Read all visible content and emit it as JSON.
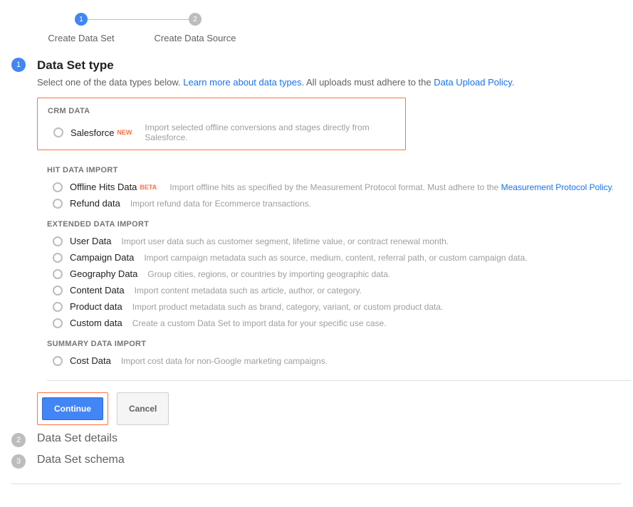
{
  "stepper": {
    "step1": {
      "num": "1",
      "label": "Create Data Set"
    },
    "step2": {
      "num": "2",
      "label": "Create Data Source"
    }
  },
  "section1": {
    "num": "1",
    "title": "Data Set type",
    "intro_prefix": "Select one of the data types below. ",
    "intro_link1": "Learn more about data types",
    "intro_mid": ". All uploads must adhere to the ",
    "intro_link2": "Data Upload Policy",
    "intro_suffix": "."
  },
  "groups": {
    "crm": {
      "header": "CRM DATA",
      "salesforce": {
        "label": "Salesforce",
        "badge": "NEW",
        "desc": "Import selected offline conversions and stages directly from Salesforce."
      }
    },
    "hit": {
      "header": "HIT DATA IMPORT",
      "offline": {
        "label": "Offline Hits Data",
        "badge": "BETA",
        "desc_pre": "Import offline hits as specified by the Measurement Protocol format. Must adhere to the ",
        "desc_link": "Measurement Protocol Policy",
        "desc_post": "."
      },
      "refund": {
        "label": "Refund data",
        "desc": "Import refund data for Ecommerce transactions."
      }
    },
    "ext": {
      "header": "EXTENDED DATA IMPORT",
      "user": {
        "label": "User Data",
        "desc": "Import user data such as customer segment, lifetime value, or contract renewal month."
      },
      "campaign": {
        "label": "Campaign Data",
        "desc": "Import campaign metadata such as source, medium, content, referral path, or custom campaign data."
      },
      "geo": {
        "label": "Geography Data",
        "desc": "Group cities, regions, or countries by importing geographic data."
      },
      "content": {
        "label": "Content Data",
        "desc": "Import content metadata such as article, author, or category."
      },
      "product": {
        "label": "Product data",
        "desc": "Import product metadata such as brand, category, variant, or custom product data."
      },
      "custom": {
        "label": "Custom data",
        "desc": "Create a custom Data Set to import data for your specific use case."
      }
    },
    "summary": {
      "header": "SUMMARY DATA IMPORT",
      "cost": {
        "label": "Cost Data",
        "desc": "Import cost data for non-Google marketing campaigns."
      }
    }
  },
  "buttons": {
    "continue": "Continue",
    "cancel": "Cancel"
  },
  "section2": {
    "num": "2",
    "title": "Data Set details"
  },
  "section3": {
    "num": "3",
    "title": "Data Set schema"
  }
}
